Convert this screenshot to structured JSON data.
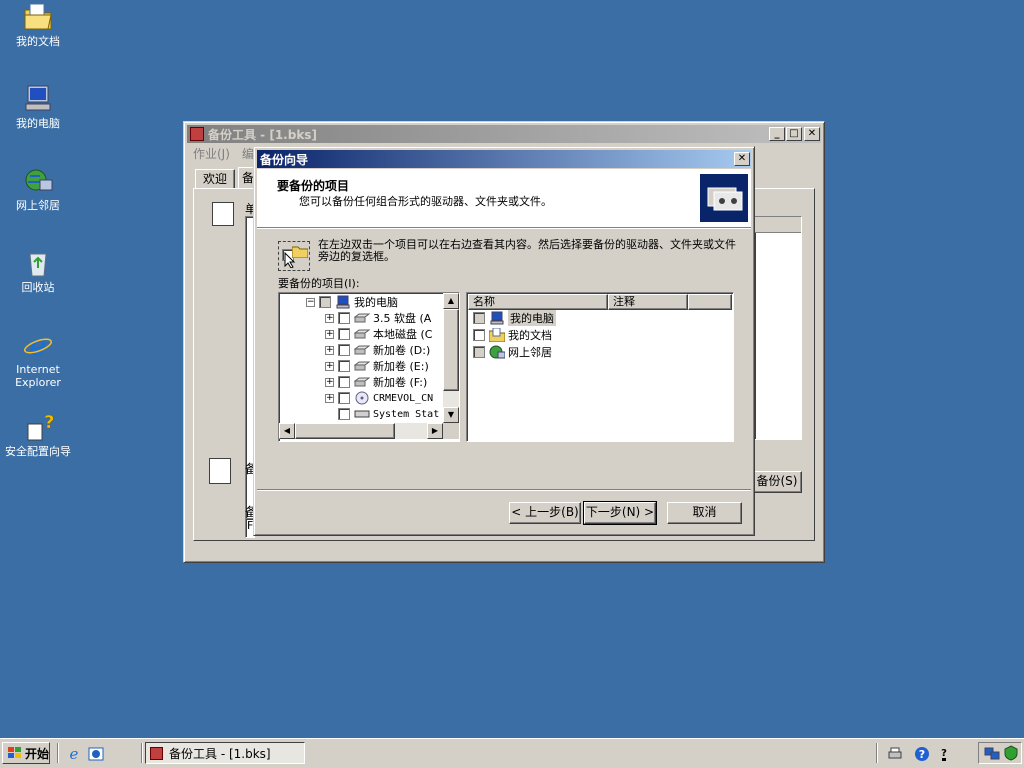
{
  "desktop": {
    "icons": [
      {
        "label": "我的文档",
        "icon": "folder-documents-icon"
      },
      {
        "label": "我的电脑",
        "icon": "computer-icon"
      },
      {
        "label": "网上邻居",
        "icon": "network-icon"
      },
      {
        "label": "回收站",
        "icon": "recycle-bin-icon"
      },
      {
        "label": "Internet Explorer",
        "icon": "internet-explorer-icon"
      },
      {
        "label": "安全配置向导",
        "icon": "security-wizard-icon"
      }
    ]
  },
  "backup_window": {
    "title": "备份工具 - [1.bks]",
    "menu": [
      "作业(J)",
      "编"
    ],
    "tabs": [
      "欢迎",
      "备"
    ],
    "side_label_top": "单",
    "side_label_bottom": "备",
    "side_label_bottom2": "备",
    "side_field_value": "F",
    "start_backup_button": "备份(S)"
  },
  "wizard": {
    "title": "备份向导",
    "header_title": "要备份的项目",
    "header_subtitle": "您可以备份任何组合形式的驱动器、文件夹或文件。",
    "instruction": "在左边双击一个项目可以在右边查看其内容。然后选择要备份的驱动器、文件夹或文件旁边的复选框。",
    "items_label": "要备份的项目(I):",
    "tree": [
      {
        "label": "我的电脑",
        "level": 0
      },
      {
        "label": "3.5 软盘 (A",
        "level": 1
      },
      {
        "label": "本地磁盘 (C",
        "level": 1
      },
      {
        "label": "新加卷 (D:)",
        "level": 1
      },
      {
        "label": "新加卷 (E:)",
        "level": 1
      },
      {
        "label": "新加卷 (F:)",
        "level": 1
      },
      {
        "label": "CRMEVOL_CN",
        "level": 1
      },
      {
        "label": "System Stat",
        "level": 1
      }
    ],
    "list_columns": [
      "名称",
      "注释"
    ],
    "list_items": [
      {
        "label": "我的电脑",
        "icon": "computer-icon"
      },
      {
        "label": "我的文档",
        "icon": "folder-documents-icon"
      },
      {
        "label": "网上邻居",
        "icon": "network-icon"
      }
    ],
    "back_button": "< 上一步(B)",
    "next_button": "下一步(N) >",
    "cancel_button": "取消"
  },
  "taskbar": {
    "start_label": "开始",
    "task_label": "备份工具 - [1.bks]"
  },
  "colors": {
    "desktop": "#3a6ea5",
    "active_title": "#0a246a",
    "inactive_title": "#808080",
    "face": "#d4d0c8"
  }
}
